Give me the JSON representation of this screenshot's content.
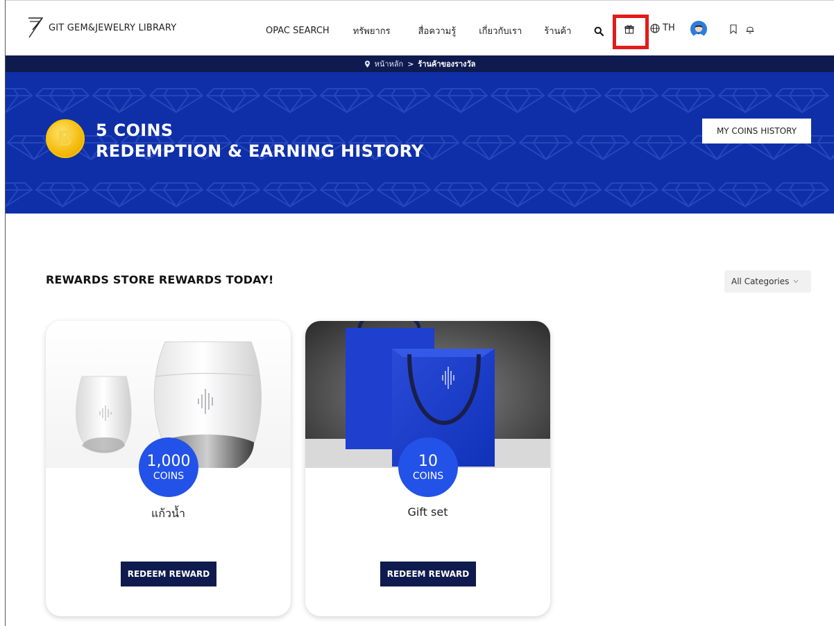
{
  "header": {
    "logo_text": "GIT GEM&JEWELRY LIBRARY",
    "nav": {
      "opac": "OPAC SEARCH",
      "resources": "ทรัพยากร",
      "knowledge": "สื่อความรู้",
      "about": "เกี่ยวกับเรา",
      "shop": "ร้านค้า"
    },
    "language": "TH",
    "icons": [
      "search-icon",
      "gift-icon",
      "globe-icon",
      "avatar",
      "bookmark-icon",
      "bell-icon"
    ],
    "highlight_color": "#e31b1b"
  },
  "breadcrumb": {
    "home": "หน้าหลัก",
    "separator": ">",
    "current": "ร้านค้าของรางวัล"
  },
  "hero": {
    "coin_symbol": "B",
    "coins_line": "5 COINS",
    "subtitle": "REDEMPTION & EARNING HISTORY",
    "history_button": "MY COINS HISTORY",
    "background_color": "#0f2fa8"
  },
  "rewards": {
    "title": "REWARDS STORE REWARDS TODAY!",
    "category_select": "All Categories",
    "items": [
      {
        "coins": "1,000",
        "unit": "COINS",
        "name": "แก้วน้ำ",
        "button": "REDEEM REWARD"
      },
      {
        "coins": "10",
        "unit": "COINS",
        "name": "Gift set",
        "button": "REDEEM REWARD"
      }
    ]
  },
  "colors": {
    "navy": "#0f1b4e",
    "badge_blue": "#2352e8",
    "coin_gold": "#f2b400"
  }
}
